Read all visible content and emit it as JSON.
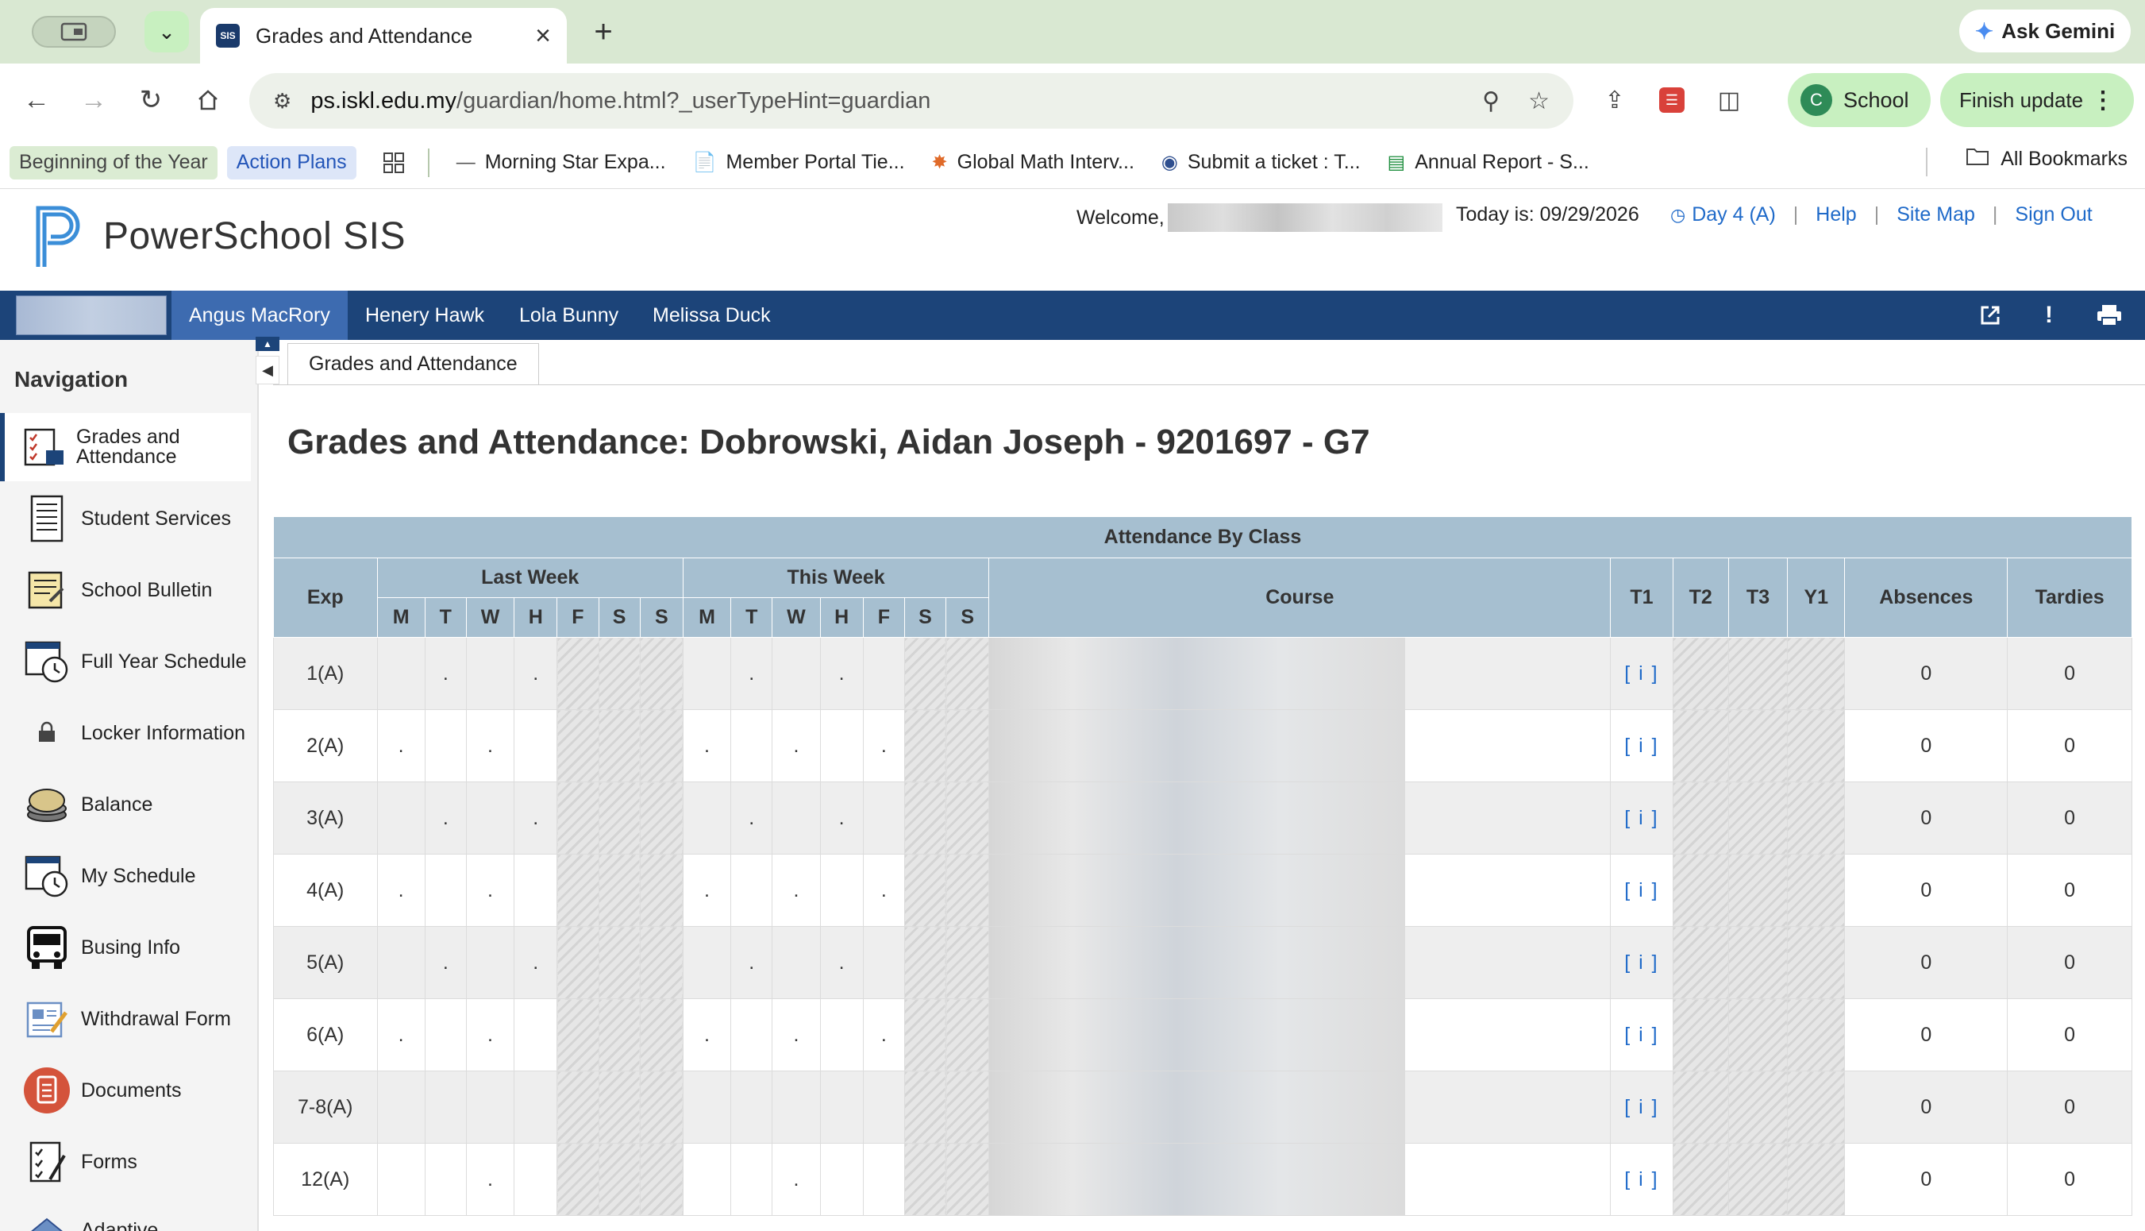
{
  "browser": {
    "tab_title": "Grades and Attendance",
    "tab_favicon": "SIS",
    "ask_gemini_label": "Ask Gemini",
    "url_host": "ps.iskl.edu.my",
    "url_path": "/guardian/home.html?_userTypeHint=guardian",
    "profile_initial": "C",
    "profile_label": "School",
    "finish_update_label": "Finish update",
    "bookmarks": {
      "chip_green": "Beginning of the Year",
      "chip_blue": "Action Plans",
      "items": [
        "Morning Star Expa...",
        "Member Portal Tie...",
        "Global Math Interv...",
        "Submit a ticket : T...",
        "Annual Report - S..."
      ],
      "all_bookmarks": "All Bookmarks"
    }
  },
  "ps": {
    "logo_text": "PowerSchool SIS",
    "welcome_label": "Welcome,",
    "today_label": "Today is: 09/29/2026",
    "day_label": "Day 4 (A)",
    "help": "Help",
    "site_map": "Site Map",
    "sign_out": "Sign Out",
    "students": [
      "Angus MacRory",
      "Henery Hawk",
      "Lola Bunny",
      "Melissa Duck"
    ],
    "active_student": "Angus MacRory"
  },
  "nav": {
    "heading": "Navigation",
    "items": [
      {
        "label": "Grades and Attendance",
        "icon": "gradebook-icon"
      },
      {
        "label": "Student Services",
        "icon": "document-list-icon"
      },
      {
        "label": "School Bulletin",
        "icon": "bulletin-icon"
      },
      {
        "label": "Full Year Schedule",
        "icon": "calendar-clock-icon"
      },
      {
        "label": "Locker Information",
        "icon": "lock-icon"
      },
      {
        "label": "Balance",
        "icon": "coins-icon"
      },
      {
        "label": "My Schedule",
        "icon": "calendar-clock-icon"
      },
      {
        "label": "Busing Info",
        "icon": "bus-icon"
      },
      {
        "label": "Withdrawal Form",
        "icon": "form-pencil-icon"
      },
      {
        "label": "Documents",
        "icon": "documents-icon"
      },
      {
        "label": "Forms",
        "icon": "checklist-icon"
      },
      {
        "label": "Adaptive",
        "icon": "adaptive-icon"
      }
    ]
  },
  "content": {
    "tab_label": "Grades and Attendance",
    "page_title": "Grades and Attendance: Dobrowski, Aidan Joseph - 9201697 - G7",
    "table": {
      "caption": "Attendance By Class",
      "col_exp": "Exp",
      "col_last_week": "Last Week",
      "col_this_week": "This Week",
      "col_course": "Course",
      "col_t1": "T1",
      "col_t2": "T2",
      "col_t3": "T3",
      "col_y1": "Y1",
      "col_absences": "Absences",
      "col_tardies": "Tardies",
      "days": [
        "M",
        "T",
        "W",
        "H",
        "F",
        "S",
        "S"
      ],
      "rows": [
        {
          "exp": "1(A)",
          "last": [
            "",
            ".",
            "",
            ".",
            "",
            "",
            ""
          ],
          "this": [
            "",
            ".",
            "",
            ".",
            "",
            "",
            ""
          ],
          "t1": "[ i ]",
          "absences": "0",
          "tardies": "0"
        },
        {
          "exp": "2(A)",
          "last": [
            ".",
            "",
            ".",
            "",
            "",
            "",
            ""
          ],
          "this": [
            ".",
            "",
            ".",
            "",
            ".",
            "",
            ""
          ],
          "t1": "[ i ]",
          "absences": "0",
          "tardies": "0"
        },
        {
          "exp": "3(A)",
          "last": [
            "",
            ".",
            "",
            ".",
            "",
            "",
            ""
          ],
          "this": [
            "",
            ".",
            "",
            ".",
            "",
            "",
            ""
          ],
          "t1": "[ i ]",
          "absences": "0",
          "tardies": "0"
        },
        {
          "exp": "4(A)",
          "last": [
            ".",
            "",
            ".",
            "",
            "",
            "",
            ""
          ],
          "this": [
            ".",
            "",
            ".",
            "",
            ".",
            "",
            ""
          ],
          "t1": "[ i ]",
          "absences": "0",
          "tardies": "0"
        },
        {
          "exp": "5(A)",
          "last": [
            "",
            ".",
            "",
            ".",
            "",
            "",
            ""
          ],
          "this": [
            "",
            ".",
            "",
            ".",
            "",
            "",
            ""
          ],
          "t1": "[ i ]",
          "absences": "0",
          "tardies": "0"
        },
        {
          "exp": "6(A)",
          "last": [
            ".",
            "",
            ".",
            "",
            "",
            "",
            ""
          ],
          "this": [
            ".",
            "",
            ".",
            "",
            ".",
            "",
            ""
          ],
          "t1": "[ i ]",
          "absences": "0",
          "tardies": "0"
        },
        {
          "exp": "7-8(A)",
          "last": [
            "",
            "",
            "",
            "",
            "",
            "",
            ""
          ],
          "this": [
            "",
            "",
            "",
            "",
            "",
            "",
            ""
          ],
          "t1": "[ i ]",
          "absences": "0",
          "tardies": "0"
        },
        {
          "exp": "12(A)",
          "last": [
            "",
            "",
            ".",
            "",
            "",
            "",
            ""
          ],
          "this": [
            "",
            "",
            ".",
            "",
            "",
            "",
            ""
          ],
          "t1": "[ i ]",
          "absences": "0",
          "tardies": "0"
        }
      ]
    }
  },
  "colors": {
    "tabstrip_bg": "#d9e8d2",
    "student_bar_bg": "#1c4479",
    "student_tab_active": "#3d6bb0",
    "table_header_bg": "#a6bfd0",
    "link_blue": "#1f6ac9"
  }
}
